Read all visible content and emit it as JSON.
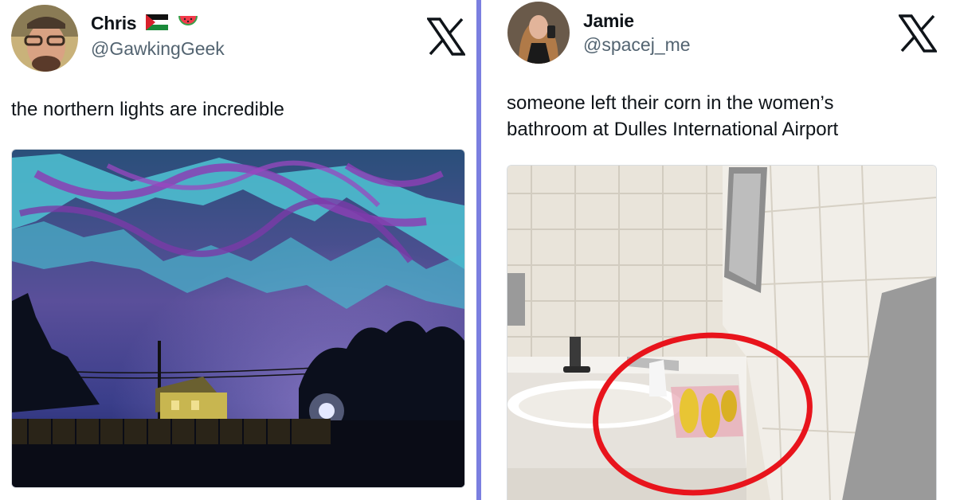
{
  "tweets": [
    {
      "display_name": "Chris",
      "handle": "@GawkingGeek",
      "name_emojis": [
        "palestine-flag",
        "watermelon"
      ],
      "text": "the northern lights are incredible",
      "photo": "northern-lights-photo"
    },
    {
      "display_name": "Jamie",
      "handle": "@spacej_me",
      "text_line1": "someone left their corn in the women’s",
      "text_line2": "bathroom at Dulles International Airport",
      "photo": "bathroom-corn-photo"
    }
  ],
  "icons": {
    "platform": "x-logo"
  },
  "colors": {
    "divider": "#7b7fe0",
    "highlight_circle": "#e8141c",
    "handle": "#536471"
  }
}
